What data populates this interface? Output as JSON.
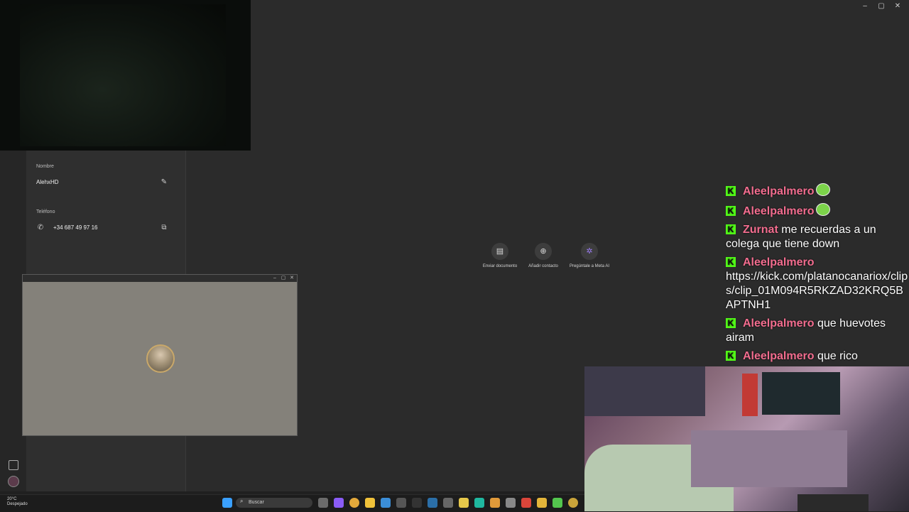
{
  "window": {
    "min": "–",
    "max": "▢",
    "close": "✕"
  },
  "contact": {
    "name_label": "Nombre",
    "name_value": "AlehxHD",
    "phone_label": "Teléfono",
    "phone_value": "+34 687 49 97 16"
  },
  "actions": [
    {
      "label": "Enviar documento",
      "icon": "document-icon"
    },
    {
      "label": "Añadir contacto",
      "icon": "add-contact-icon"
    },
    {
      "label": "Pregúntale a Meta AI",
      "icon": "meta-ai-icon"
    }
  ],
  "call_window": {
    "min": "–",
    "max": "▢",
    "close": "✕"
  },
  "chat": [
    {
      "user": "Aleelpalmero",
      "text": "",
      "emote": true
    },
    {
      "user": "Aleelpalmero",
      "text": "",
      "emote": true
    },
    {
      "user": "Zurnat",
      "text": "me recuerdas a un colega que tiene down",
      "emote": false
    },
    {
      "user": "Aleelpalmero",
      "text": "https://kick.com/platanocanariox/clips/clip_01M094R5RKZAD32KRQ5BAPTNH1",
      "emote": false,
      "newline": true
    },
    {
      "user": "Aleelpalmero",
      "text": "que huevotes airam",
      "emote": false
    },
    {
      "user": "Aleelpalmero",
      "text": "que rico",
      "emote": false
    }
  ],
  "badge": "K",
  "taskbar": {
    "temperature": "20°C",
    "weather": "Despejado",
    "search_placeholder": "Buscar"
  },
  "colors": {
    "kick_green": "#53fc18",
    "username_pink": "#f26d8f",
    "app_bg": "#2b2b2b"
  }
}
